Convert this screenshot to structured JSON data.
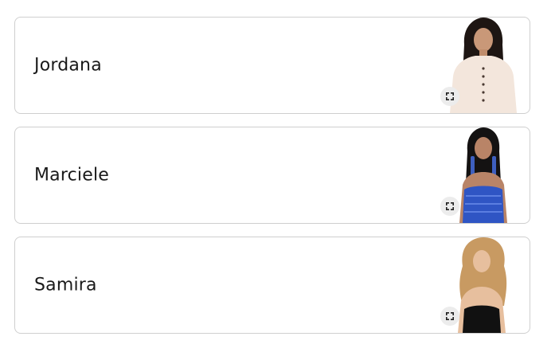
{
  "poll": {
    "options": [
      {
        "name": "Jordana",
        "photo_icon": "participant-photo",
        "expand_icon": "expand-icon"
      },
      {
        "name": "Marciele",
        "photo_icon": "participant-photo",
        "expand_icon": "expand-icon"
      },
      {
        "name": "Samira",
        "photo_icon": "participant-photo",
        "expand_icon": "expand-icon"
      }
    ]
  },
  "colors": {
    "card_border": "#cfcfcf",
    "text": "#1a1a1a",
    "expand_button_bg": "#ececec",
    "outfit_jordana": "#f3e6dc",
    "outfit_marciele": "#2f55c4",
    "outfit_samira": "#111111"
  }
}
